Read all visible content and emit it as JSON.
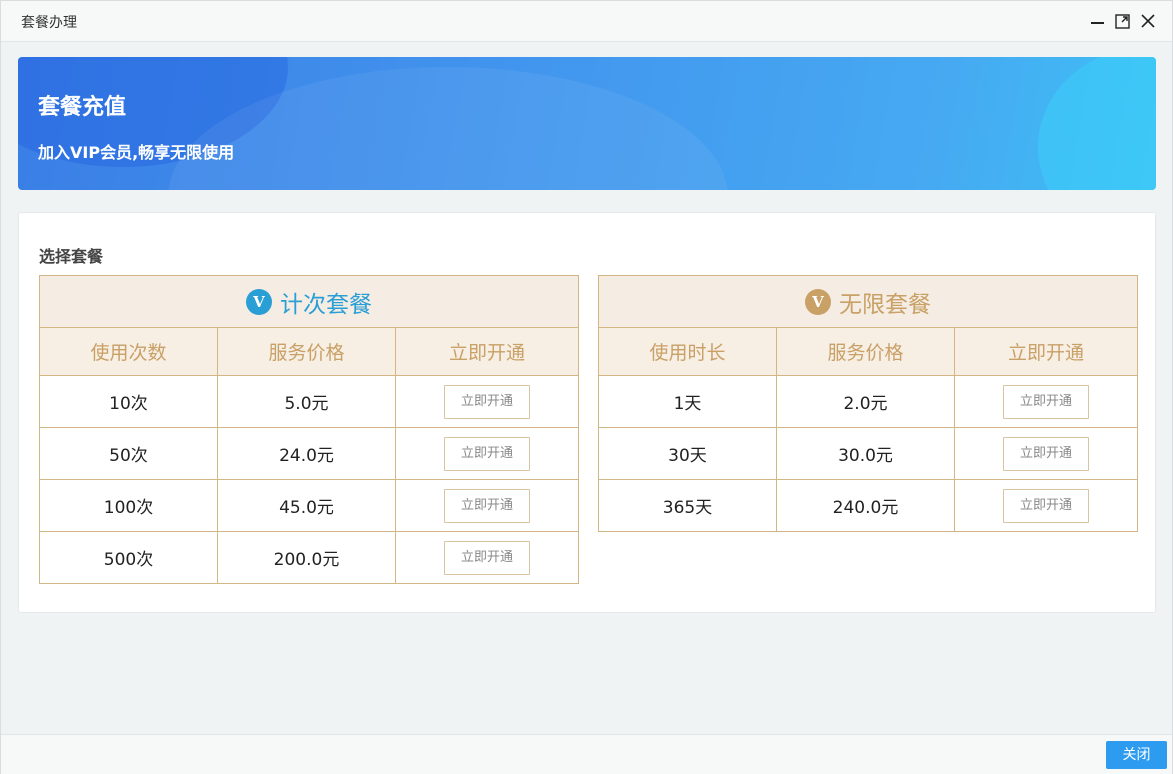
{
  "window": {
    "title": "套餐办理"
  },
  "banner": {
    "title": "套餐充值",
    "subtitle": "加入VIP会员,畅享无限使用"
  },
  "panel": {
    "section_title": "选择套餐"
  },
  "count_package": {
    "badge": "V",
    "title": "计次套餐",
    "columns": [
      "使用次数",
      "服务价格",
      "立即开通"
    ],
    "rows": [
      {
        "quantity": "10次",
        "price": "5.0元",
        "action": "立即开通"
      },
      {
        "quantity": "50次",
        "price": "24.0元",
        "action": "立即开通"
      },
      {
        "quantity": "100次",
        "price": "45.0元",
        "action": "立即开通"
      },
      {
        "quantity": "500次",
        "price": "200.0元",
        "action": "立即开通"
      }
    ]
  },
  "unlimited_package": {
    "badge": "V",
    "title": "无限套餐",
    "columns": [
      "使用时长",
      "服务价格",
      "立即开通"
    ],
    "rows": [
      {
        "quantity": "1天",
        "price": "2.0元",
        "action": "立即开通"
      },
      {
        "quantity": "30天",
        "price": "30.0元",
        "action": "立即开通"
      },
      {
        "quantity": "365天",
        "price": "240.0元",
        "action": "立即开通"
      }
    ]
  },
  "footer": {
    "close_label": "关闭"
  },
  "colors": {
    "accent_blue": "#2d9cf0",
    "count_title": "#2a9fd6",
    "gold": "#c9a066",
    "table_border": "#d2b785",
    "header_bg": "#f5ede3"
  }
}
